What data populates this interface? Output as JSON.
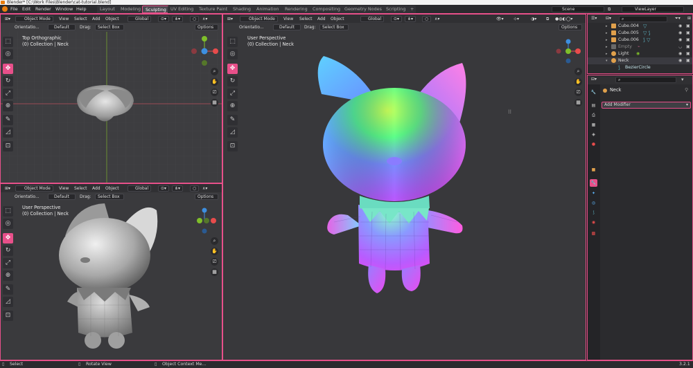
{
  "title_bar": {
    "text": "Blender* [C:\\Work Files\\Blender\\cat-tutorial.blend]"
  },
  "menu": [
    "File",
    "Edit",
    "Render",
    "Window",
    "Help"
  ],
  "workspaces": [
    "Layout",
    "Modeling",
    "Sculpting",
    "UV Editing",
    "Texture Paint",
    "Shading",
    "Animation",
    "Rendering",
    "Compositing",
    "Geometry Nodes",
    "Scripting",
    "+"
  ],
  "active_workspace": "Sculpting",
  "scene": {
    "value": "Scene"
  },
  "view_layer": {
    "value": "ViewLayer"
  },
  "viewport_common": {
    "mode": "Object Mode",
    "view": "View",
    "select": "Select",
    "add": "Add",
    "object": "Object",
    "global": "Global",
    "orientation_label": "Orientatio...",
    "orientation_value": "Default",
    "drag_label": "Drag:",
    "drag_value": "Select Box",
    "options": "Options"
  },
  "viewport_top_left": {
    "view_name": "Top Orthographic",
    "collection": "(0) Collection | Neck"
  },
  "viewport_bottom_left": {
    "view_name": "User Perspective",
    "collection": "(0) Collection | Neck"
  },
  "viewport_main": {
    "view_name": "User Perspective",
    "collection": "(0) Collection | Neck"
  },
  "outliner": {
    "items": [
      {
        "name": "Cube.004",
        "icon": "mesh-icon",
        "color": "#e0a04c"
      },
      {
        "name": "Cube.005",
        "icon": "mesh-icon",
        "color": "#e0a04c"
      },
      {
        "name": "Cube.006",
        "icon": "mesh-icon",
        "color": "#e0a04c"
      },
      {
        "name": "Empty",
        "icon": "empty-icon",
        "color": "#888888"
      },
      {
        "name": "Light",
        "icon": "light-icon",
        "color": "#e0a04c"
      },
      {
        "name": "Neck",
        "icon": "curve-icon",
        "color": "#e0a04c"
      },
      {
        "name": "BezierCircle",
        "icon": "curve-data-icon",
        "color": "#5fb8c8"
      }
    ]
  },
  "properties": {
    "object_name": "Neck",
    "add_modifier": "Add Modifier"
  },
  "status_bar": {
    "select": "Select",
    "rotate": "Rotate View",
    "context": "Object Context Me...",
    "version": "3.2.1"
  },
  "colors": {
    "accent": "#e8508a",
    "x_axis": "#e84c4c",
    "y_axis": "#7fbf2a",
    "z_axis": "#3d8fe0"
  }
}
